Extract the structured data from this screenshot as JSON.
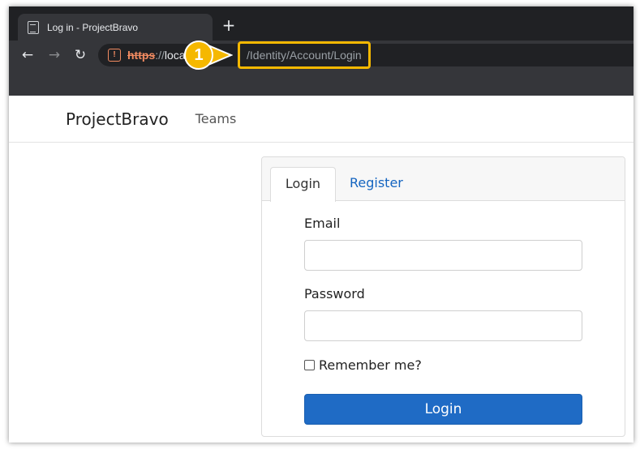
{
  "browser": {
    "tab_title": "Log in - ProjectBravo",
    "new_tab_symbol": "+",
    "url": {
      "scheme": "https",
      "separator": "://",
      "host": "loca",
      "path": "/Identity/Account/Login"
    },
    "callout_number": "1",
    "colors": {
      "insecure": "#f28b61",
      "highlight": "#f5b800"
    }
  },
  "navbar": {
    "brand": "ProjectBravo",
    "links": [
      "Teams"
    ]
  },
  "login_card": {
    "tabs": [
      {
        "label": "Login",
        "active": true
      },
      {
        "label": "Register",
        "active": false
      }
    ],
    "email_label": "Email",
    "email_value": "",
    "password_label": "Password",
    "password_value": "",
    "remember_label": "Remember me?",
    "remember_checked": false,
    "submit_label": "Login",
    "colors": {
      "primary": "#1f6bc5",
      "link": "#1565c0"
    }
  }
}
